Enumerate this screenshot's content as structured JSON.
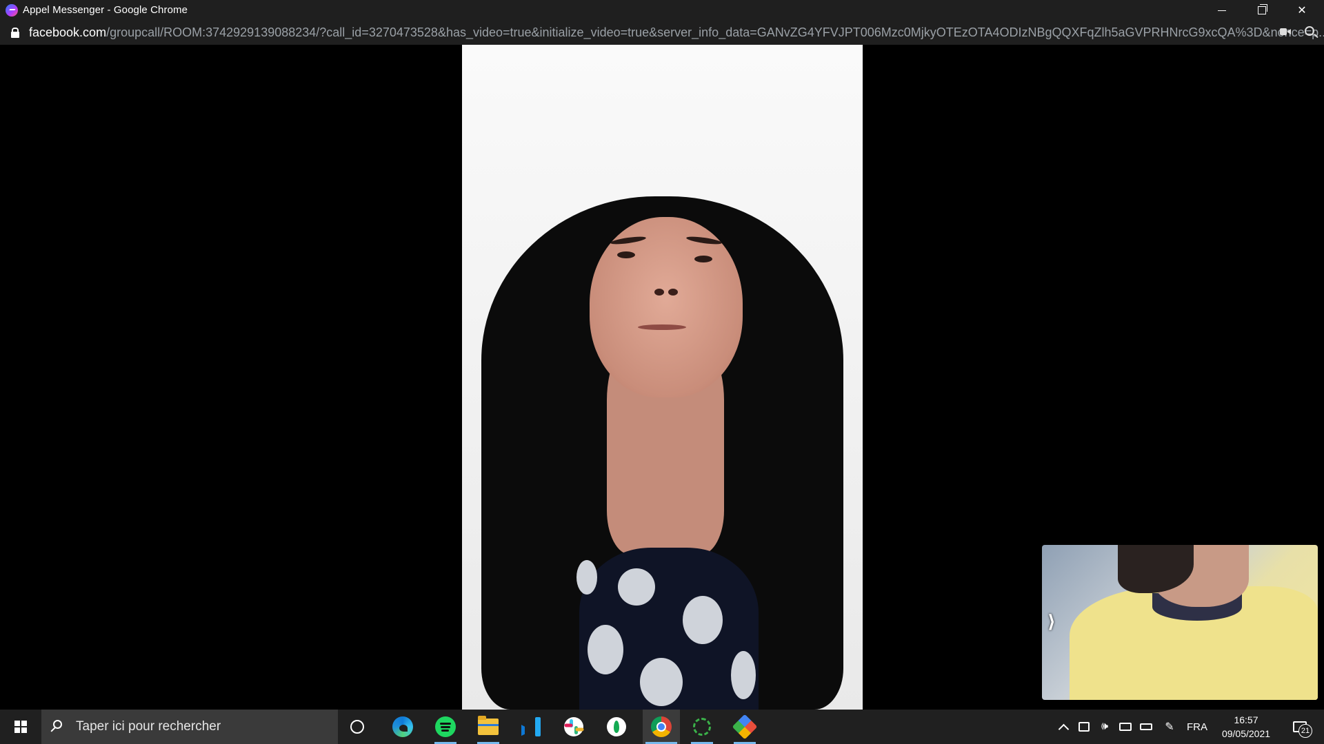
{
  "window": {
    "title": "Appel Messenger - Google Chrome",
    "controls": [
      "minimize",
      "restore",
      "close"
    ]
  },
  "addressbar": {
    "domain": "facebook.com",
    "path": "/groupcall/ROOM:3742929139088234/?call_id=3270473528&has_video=true&initialize_video=true&server_info_data=GANvZG4YFVJPT006Mzc0MjkyOTEzOTA4ODIzNBgQQXFqZlh5aGVPRHNrcG9xcQA%3D&nonce=p...",
    "icons": [
      "lock-icon",
      "camera-in-use-icon",
      "zoom-icon"
    ]
  },
  "call": {
    "self_view_chevron": "⟩"
  },
  "taskbar": {
    "search_placeholder": "Taper ici pour rechercher",
    "apps": [
      "cortana",
      "edge",
      "spotify",
      "file-explorer",
      "vscode",
      "slack",
      "mongodb-compass",
      "chrome",
      "green-ring-app",
      "git-app"
    ],
    "active_app": "chrome",
    "language": "FRA",
    "time": "16:57",
    "date": "09/05/2021",
    "notification_count": "21"
  }
}
